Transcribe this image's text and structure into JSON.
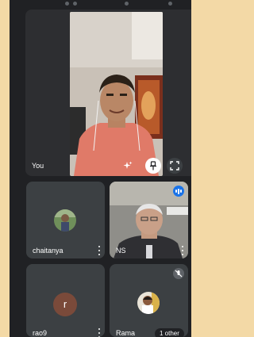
{
  "self": {
    "label": "You"
  },
  "participants": [
    {
      "name": "chaitanya"
    },
    {
      "name": "NS"
    },
    {
      "name": "rao9",
      "initial": "r"
    },
    {
      "name": "Rama",
      "badge": "1 other"
    }
  ],
  "colors": {
    "page_bg": "#f3d9a6",
    "app_bg": "#202124",
    "tile_bg": "#3c4043",
    "speaking_accent": "#1a73e8",
    "avatar_r": "#7a4a3a"
  }
}
